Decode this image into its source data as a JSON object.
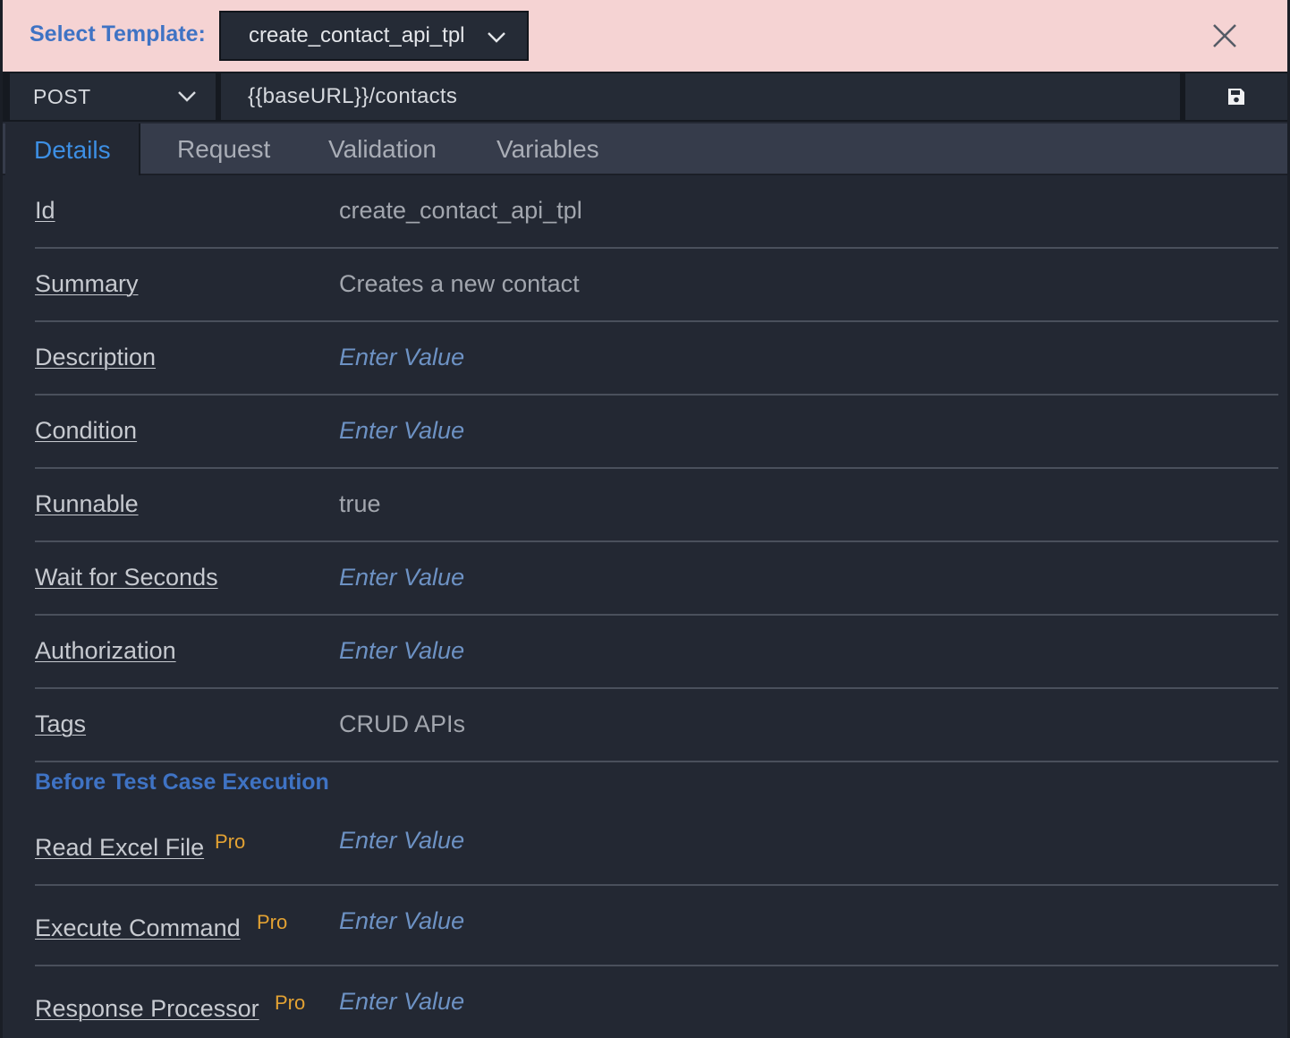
{
  "template": {
    "label": "Select Template:",
    "selected": "create_contact_api_tpl"
  },
  "request": {
    "method": "POST",
    "url": "{{baseURL}}/contacts"
  },
  "tabs": [
    {
      "label": "Details"
    },
    {
      "label": "Request"
    },
    {
      "label": "Validation"
    },
    {
      "label": "Variables"
    }
  ],
  "active_tab": "Details",
  "details": [
    {
      "label": "Id",
      "value": "create_contact_api_tpl"
    },
    {
      "label": "Summary",
      "value": "Creates a new contact"
    },
    {
      "label": "Description",
      "value": "Enter Value"
    },
    {
      "label": "Condition",
      "value": "Enter Value"
    },
    {
      "label": "Runnable",
      "value": "true"
    },
    {
      "label": "Wait for Seconds",
      "value": "Enter Value"
    },
    {
      "label": "Authorization",
      "value": "Enter Value"
    },
    {
      "label": "Tags",
      "value": "CRUD APIs"
    }
  ],
  "before_section": {
    "title": "Before Test Case Execution",
    "items": [
      {
        "label": "Read Excel File",
        "badge": "Pro",
        "value": "Enter Value"
      },
      {
        "label": "Execute Command",
        "badge": "Pro",
        "value": "Enter Value"
      },
      {
        "label": "Response Processor",
        "badge": "Pro",
        "value": "Enter Value"
      }
    ]
  },
  "icons": {
    "close": "close-icon",
    "save": "save-icon",
    "dropdown": "chevron-down-icon"
  },
  "colors": {
    "header_bg": "#f5d3d3",
    "accent": "#3f73c4",
    "tab_active": "#3d8fe4",
    "pro_badge": "#e3a233",
    "placeholder": "#6d92c4"
  }
}
